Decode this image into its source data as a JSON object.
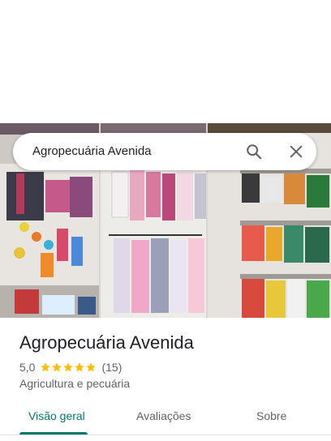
{
  "search": {
    "query": "Agropecuária Avenida"
  },
  "place": {
    "name": "Agropecuária Avenida",
    "rating": "5,0",
    "stars": 5,
    "review_count": "(15)",
    "category": "Agricultura e pecuária"
  },
  "tabs": [
    {
      "label": "Visão geral",
      "active": true
    },
    {
      "label": "Avaliações",
      "active": false
    },
    {
      "label": "Sobre",
      "active": false
    }
  ],
  "colors": {
    "accent": "#00796b",
    "star": "#fbbc04",
    "text_primary": "#202124",
    "text_secondary": "#5f6368"
  }
}
